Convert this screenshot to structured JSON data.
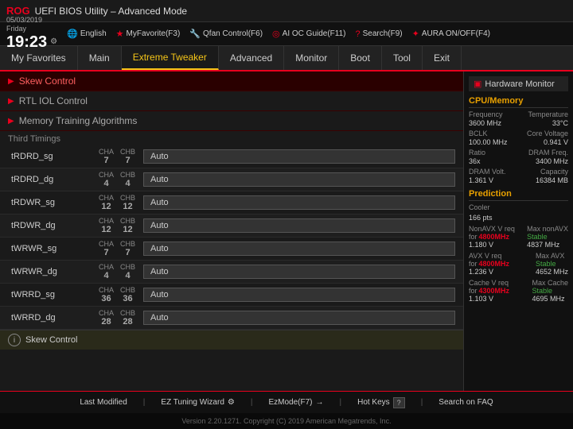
{
  "titlebar": {
    "logo": "ROG",
    "title": "UEFI BIOS Utility – Advanced Mode"
  },
  "infobar": {
    "date": "05/03/2019",
    "day": "Friday",
    "time": "19:23",
    "gear_symbol": "⚙",
    "lang_icon": "🌐",
    "language": "English",
    "myfavorites": "MyFavorite(F3)",
    "qfan": "Qfan Control(F6)",
    "ai_oc": "AI OC Guide(F11)",
    "search": "Search(F9)",
    "aura": "AURA ON/OFF(F4)"
  },
  "nav": {
    "tabs": [
      {
        "id": "my-favorites",
        "label": "My Favorites",
        "active": false
      },
      {
        "id": "main",
        "label": "Main",
        "active": false
      },
      {
        "id": "extreme-tweaker",
        "label": "Extreme Tweaker",
        "active": true
      },
      {
        "id": "advanced",
        "label": "Advanced",
        "active": false
      },
      {
        "id": "monitor",
        "label": "Monitor",
        "active": false
      },
      {
        "id": "boot",
        "label": "Boot",
        "active": false
      },
      {
        "id": "tool",
        "label": "Tool",
        "active": false
      },
      {
        "id": "exit",
        "label": "Exit",
        "active": false
      }
    ]
  },
  "sections": [
    {
      "id": "skew-control",
      "label": "Skew Control",
      "collapsed": false
    },
    {
      "id": "rtl-iol-control",
      "label": "RTL IOL Control",
      "collapsed": true
    },
    {
      "id": "memory-training",
      "label": "Memory Training Algorithms",
      "collapsed": true
    }
  ],
  "third_timings_label": "Third Timings",
  "timings_rows": [
    {
      "label": "tRDRD_sg",
      "cha_label": "CHA",
      "cha_val": "7",
      "chb_label": "CHB",
      "chb_val": "7",
      "value": "Auto"
    },
    {
      "label": "tRDRD_dg",
      "cha_label": "CHA",
      "cha_val": "4",
      "chb_label": "CHB",
      "chb_val": "4",
      "value": "Auto"
    },
    {
      "label": "tRDWR_sg",
      "cha_label": "CHA",
      "cha_val": "12",
      "chb_label": "CHB",
      "chb_val": "12",
      "value": "Auto"
    },
    {
      "label": "tRDWR_dg",
      "cha_label": "CHA",
      "cha_val": "12",
      "chb_label": "CHB",
      "chb_val": "12",
      "value": "Auto"
    },
    {
      "label": "tWRWR_sg",
      "cha_label": "CHA",
      "cha_val": "7",
      "chb_label": "CHB",
      "chb_val": "7",
      "value": "Auto"
    },
    {
      "label": "tWRWR_dg",
      "cha_label": "CHA",
      "cha_val": "4",
      "chb_label": "CHB",
      "chb_val": "4",
      "value": "Auto"
    },
    {
      "label": "tWRRD_sg",
      "cha_label": "CHA",
      "cha_val": "36",
      "chb_label": "CHB",
      "chb_val": "36",
      "value": "Auto"
    },
    {
      "label": "tWRRD_dg",
      "cha_label": "CHA",
      "cha_val": "28",
      "chb_label": "CHB",
      "chb_val": "28",
      "value": "Auto"
    }
  ],
  "skew_info_label": "Skew Control",
  "hardware_monitor": {
    "title": "Hardware Monitor",
    "cpu_memory_title": "CPU/Memory",
    "frequency_label": "Frequency",
    "frequency_value": "3600 MHz",
    "temperature_label": "Temperature",
    "temperature_value": "33°C",
    "bclk_label": "BCLK",
    "bclk_value": "100.00 MHz",
    "core_voltage_label": "Core Voltage",
    "core_voltage_value": "0.941 V",
    "ratio_label": "Ratio",
    "ratio_value": "36x",
    "dram_freq_label": "DRAM Freq.",
    "dram_freq_value": "3400 MHz",
    "dram_volt_label": "DRAM Volt.",
    "dram_volt_value": "1.361 V",
    "capacity_label": "Capacity",
    "capacity_value": "16384 MB"
  },
  "prediction": {
    "title": "Prediction",
    "cooler_label": "Cooler",
    "cooler_value": "166 pts",
    "non_avx_v_req_label": "NonAVX V req",
    "non_avx_for_label": "for",
    "non_avx_for_value": "4800MHz",
    "non_avx_v_value": "1.180 V",
    "max_non_avx_label": "Max nonAVX",
    "max_non_avx_value": "Stable",
    "max_non_avx_freq": "4837 MHz",
    "avx_v_req_label": "AVX V req",
    "avx_for_label": "for",
    "avx_for_value": "4800MHz",
    "avx_v_value": "1.236 V",
    "max_avx_label": "Max AVX",
    "max_avx_value": "Stable",
    "max_avx_freq": "4652 MHz",
    "cache_v_req_label": "Cache V req",
    "cache_for_label": "for",
    "cache_for_value": "4300MHz",
    "cache_v_value": "1.103 V",
    "max_cache_label": "Max Cache",
    "max_cache_value": "Stable",
    "max_cache_freq": "4695 MHz"
  },
  "bottombar": {
    "last_modified": "Last Modified",
    "ez_tuning": "EZ Tuning Wizard",
    "ez_mode": "EzMode(F7)",
    "ez_mode_symbol": "→",
    "hot_keys": "Hot Keys",
    "hot_keys_key": "?",
    "search_faq": "Search on FAQ"
  },
  "version": "Version 2.20.1271. Copyright (C) 2019 American Megatrends, Inc."
}
